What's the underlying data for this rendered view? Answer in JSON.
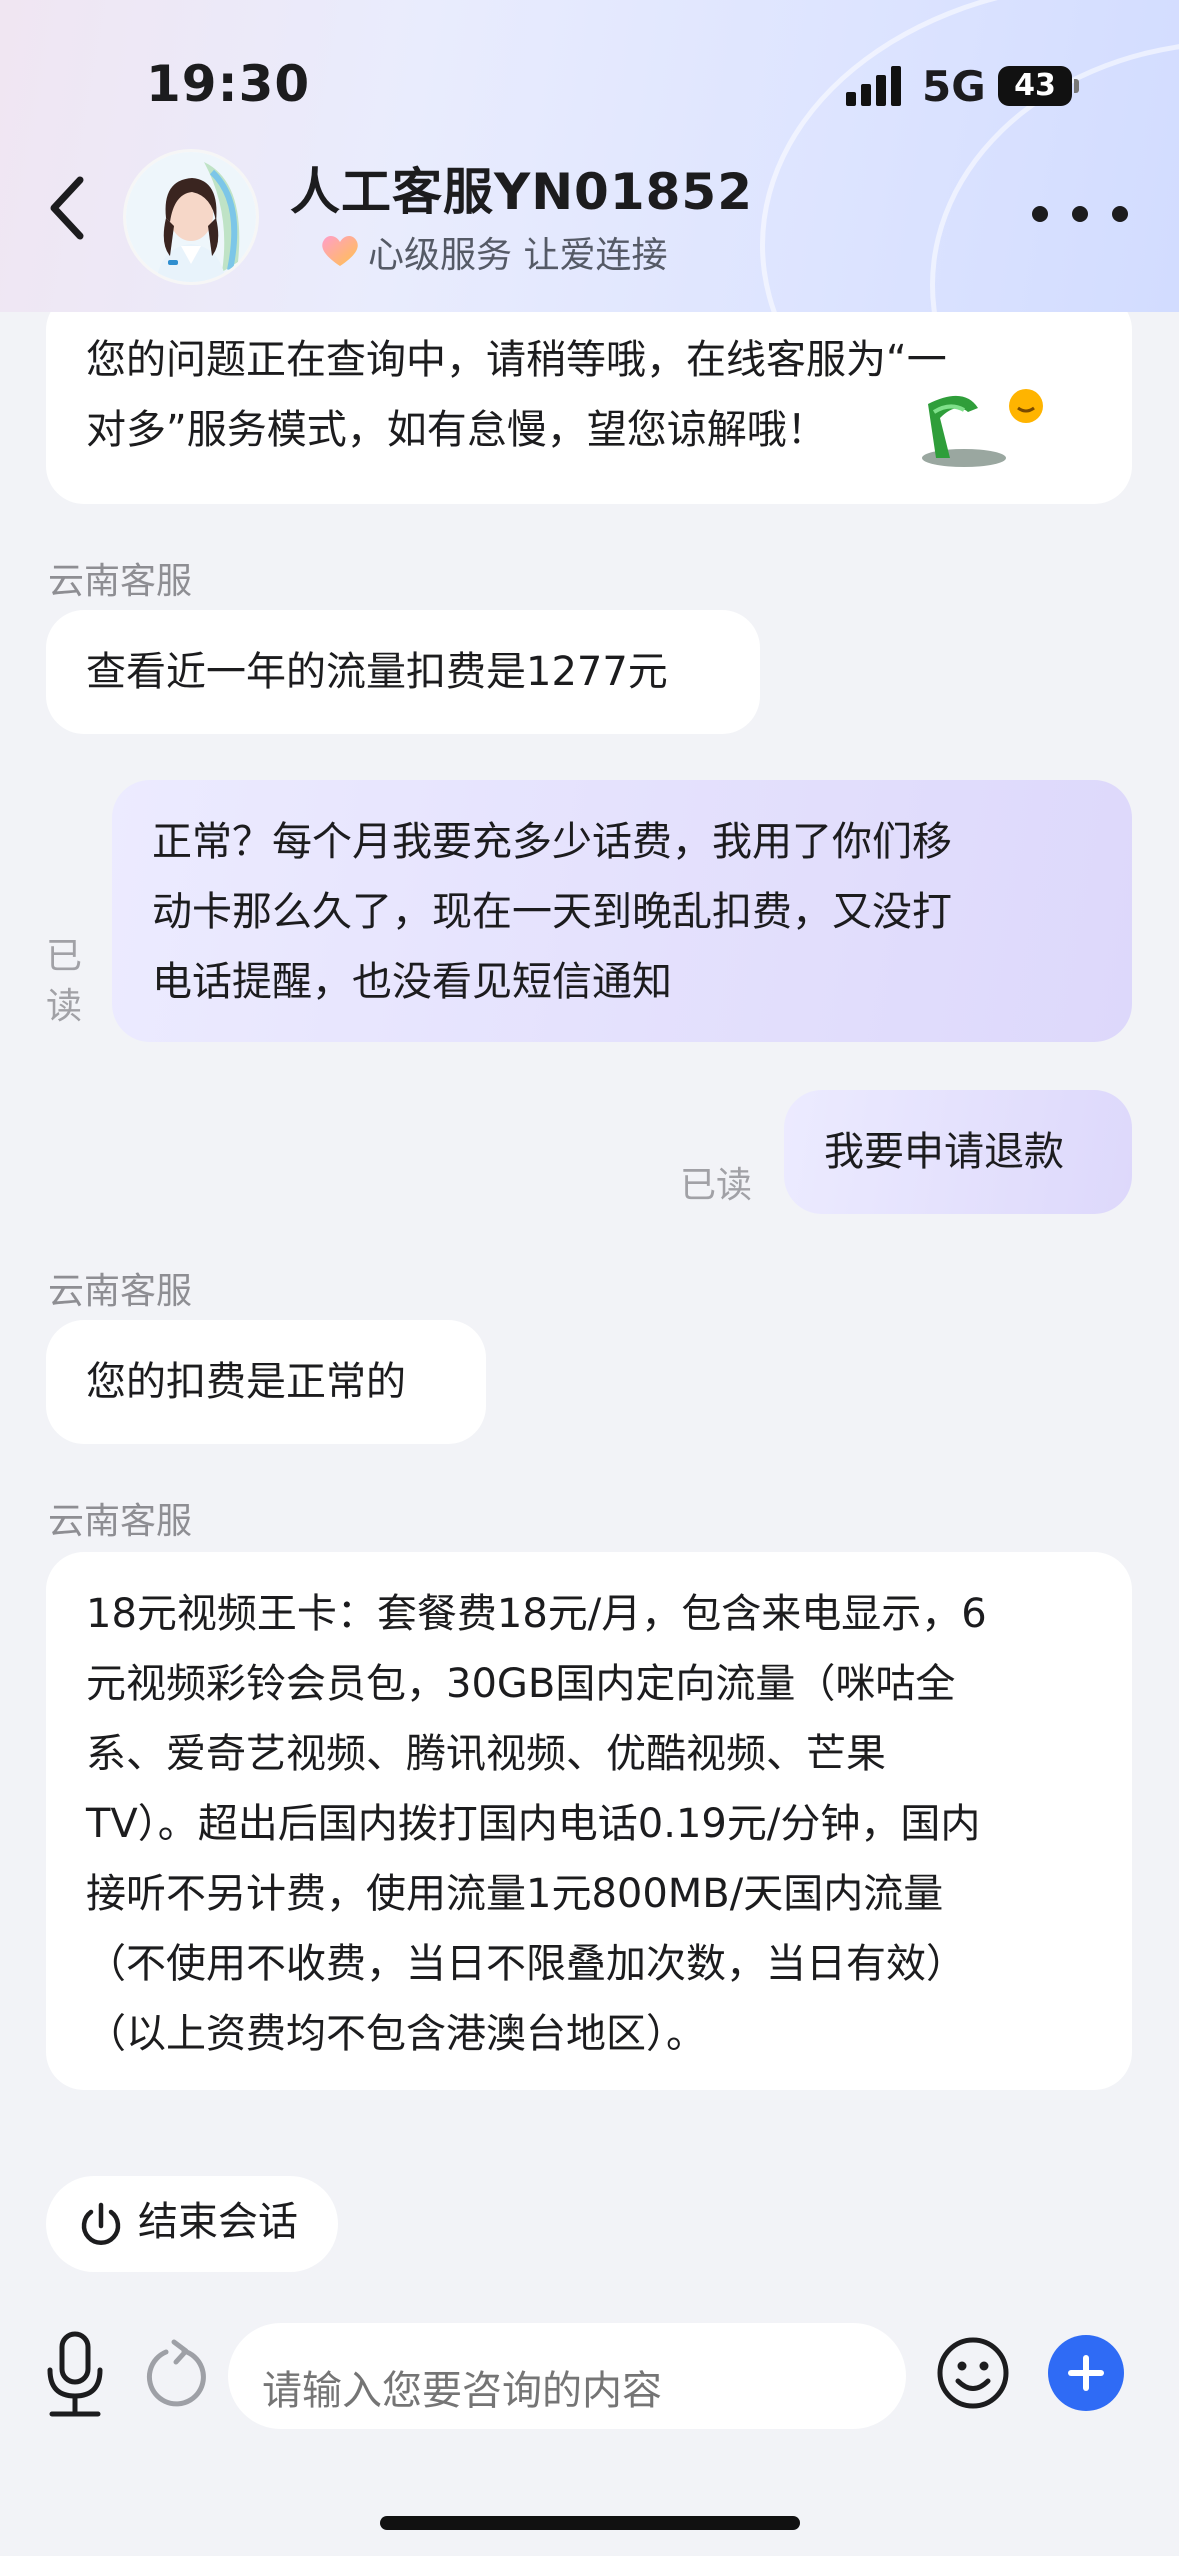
{
  "status_bar": {
    "time": "19:30",
    "network": "5G",
    "battery": "43"
  },
  "header": {
    "agent_name": "人工客服YN01852",
    "slogan": "心级服务 让爱连接"
  },
  "messages": [
    {
      "from": "agent",
      "lines": [
        "您的问题正在查询中，请稍等哦，在线客服为“一",
        "对多”服务模式，如有怠慢，望您谅解哦！"
      ]
    },
    {
      "from": "agent",
      "sender": "云南客服",
      "lines": [
        "查看近一年的流量扣费是1277元"
      ]
    },
    {
      "from": "user",
      "read": "已读",
      "lines": [
        "正常？每个月我要充多少话费，我用了你们移",
        "动卡那么久了，现在一天到晚乱扣费，又没打",
        "电话提醒，也没看见短信通知"
      ]
    },
    {
      "from": "user",
      "read": "已读",
      "lines": [
        "我要申请退款"
      ]
    },
    {
      "from": "agent",
      "sender": "云南客服",
      "lines": [
        "您的扣费是正常的"
      ]
    },
    {
      "from": "agent",
      "sender": "云南客服",
      "lines": [
        "18元视频王卡：套餐费18元/月，包含来电显示，6",
        "元视频彩铃会员包，30GB国内定向流量（咪咕全",
        "系、爱奇艺视频、腾讯视频、优酷视频、芒果",
        "TV）。超出后国内拨打国内电话0.19元/分钟，国内",
        "接听不另计费，使用流量1元800MB/天国内流量",
        "（不使用不收费，当日不限叠加次数，当日有效）",
        "（以上资费均不包含港澳台地区）。"
      ]
    }
  ],
  "read_vertical": [
    "已",
    "读"
  ],
  "end_session": {
    "label": "结束会话"
  },
  "input_bar": {
    "placeholder": "请输入您要咨询的内容"
  },
  "colors": {
    "accent": "#2f6bf5",
    "user_bubble": "#e3e0fc",
    "agent_bubble": "#ffffff",
    "background": "#f2f3f7"
  }
}
